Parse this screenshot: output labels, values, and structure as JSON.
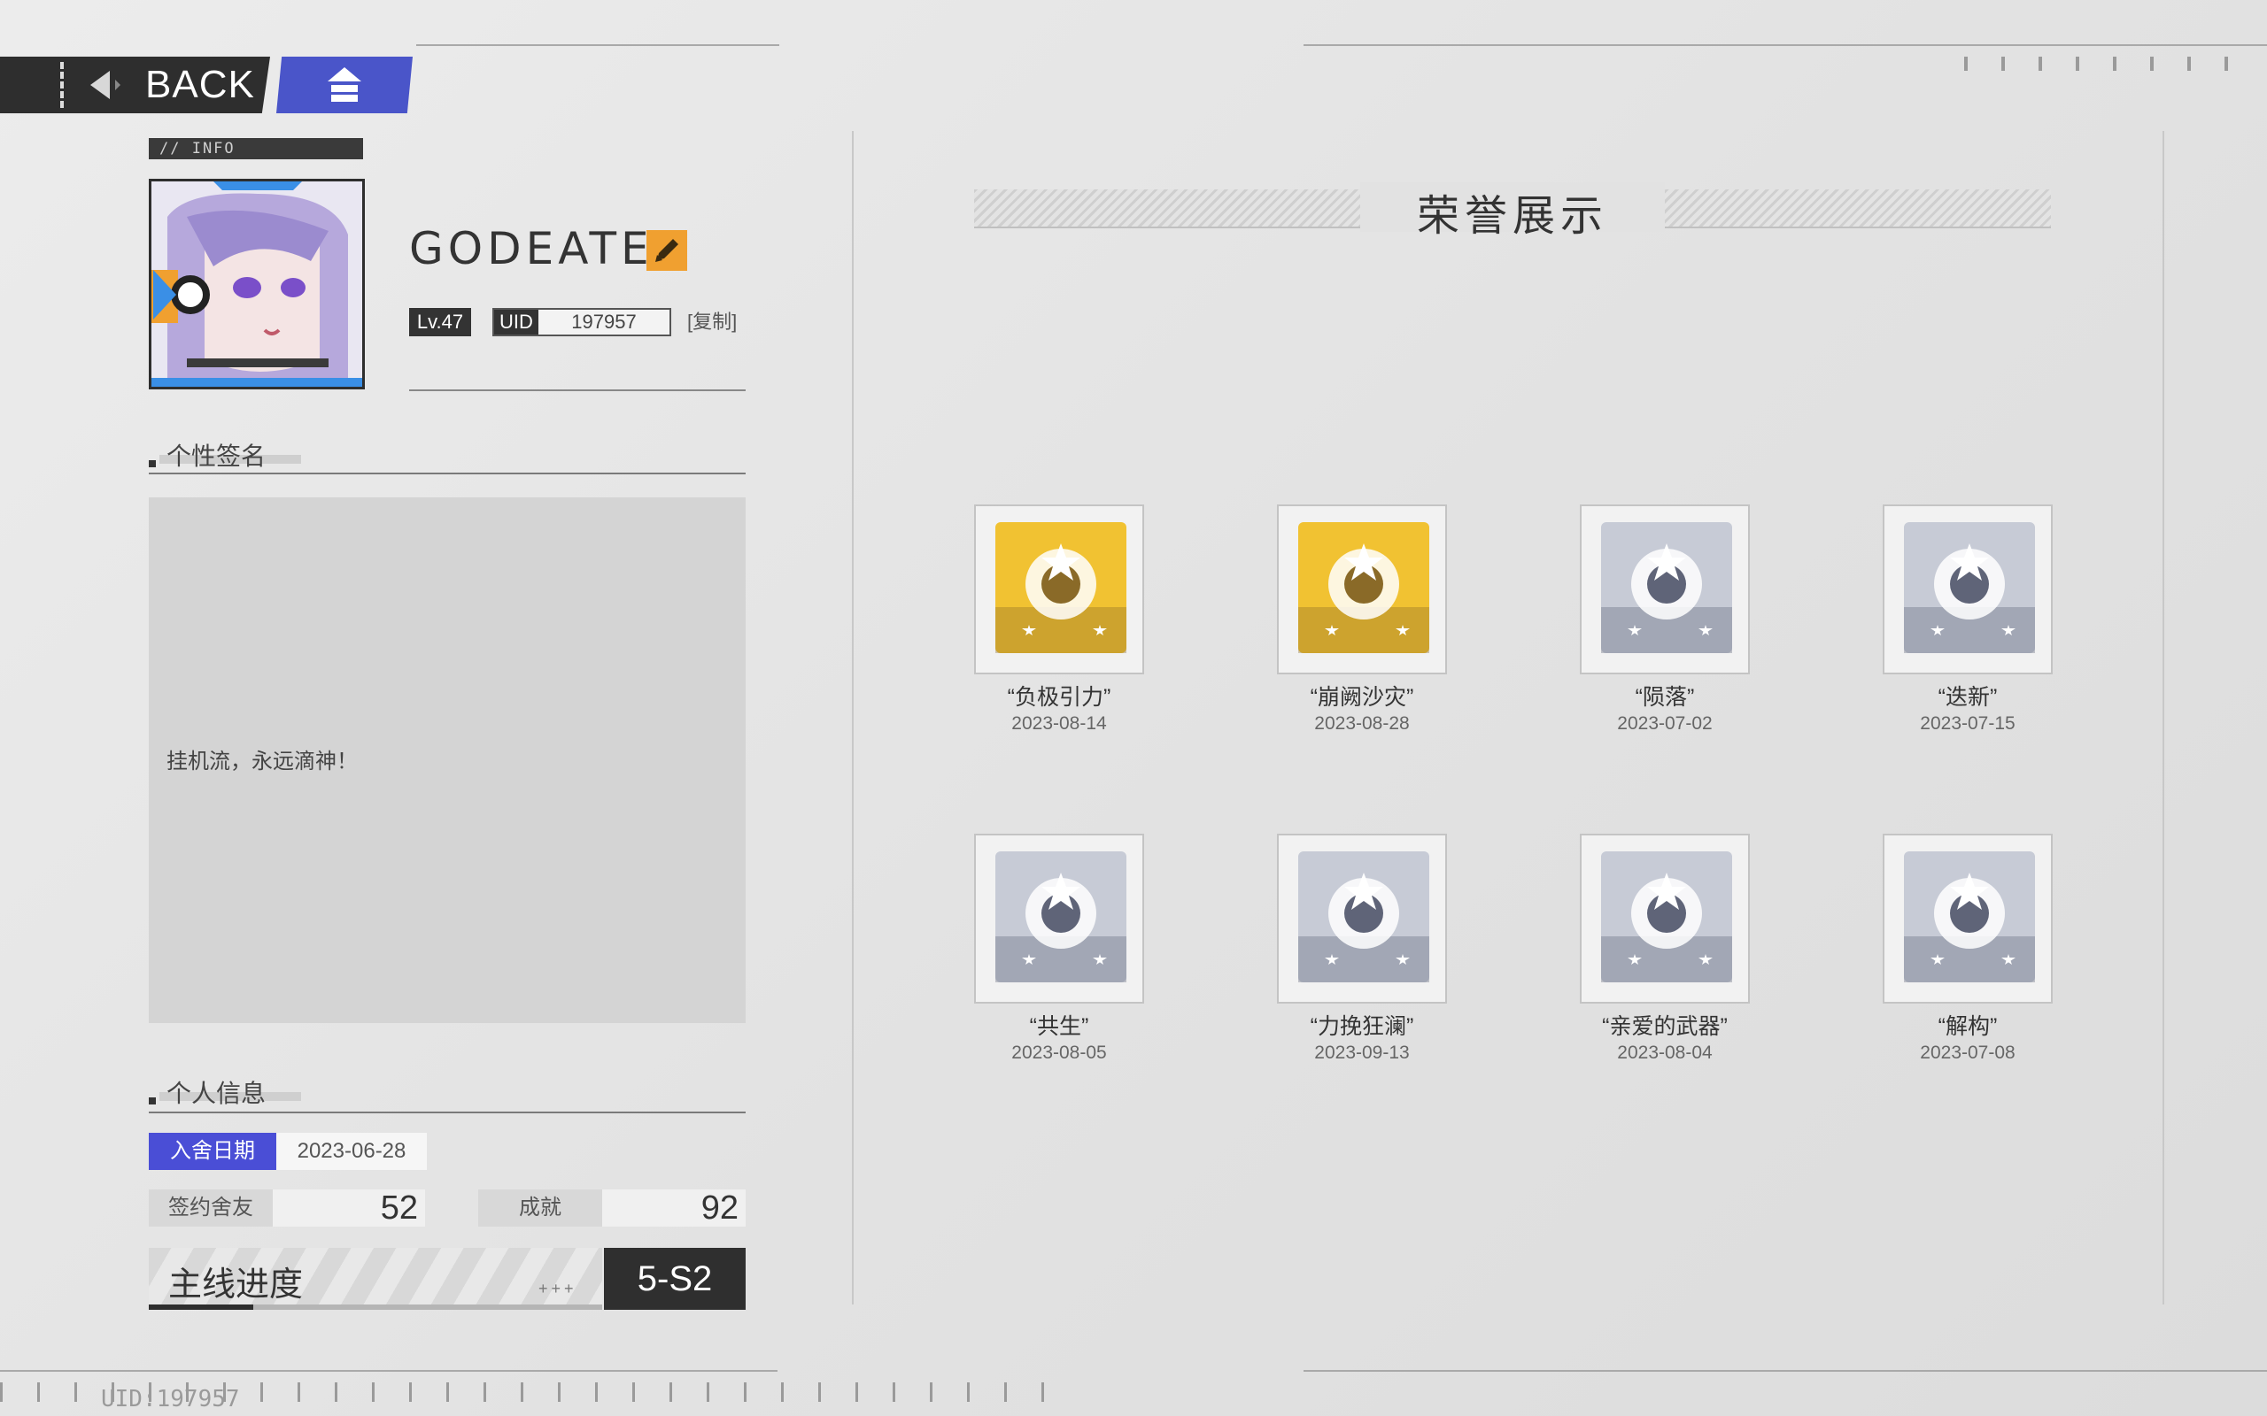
{
  "nav": {
    "back_label": "BACK"
  },
  "profile": {
    "info_tag": "// INFO",
    "name": "GODEATER",
    "level": "Lv.47",
    "uid_label": "UID",
    "uid": "197957",
    "copy_label": "[复制]"
  },
  "signature": {
    "title": "个性签名",
    "text": "挂机流，永远滴神！"
  },
  "personal": {
    "title": "个人信息",
    "join_label": "入舍日期",
    "join_date": "2023-06-28",
    "friends_label": "签约舍友",
    "friends_value": "52",
    "achievements_label": "成就",
    "achievements_value": "92",
    "progress_label": "主线进度",
    "progress_plus": "+++",
    "progress_value": "5-S2",
    "progress_fill_fraction": 0.23
  },
  "honor": {
    "title": "荣誉展示",
    "medals": [
      {
        "name": "“负极引力”",
        "date": "2023-08-14",
        "tier": "gold",
        "icon": "medal-gravity-icon"
      },
      {
        "name": "“崩阙沙灾”",
        "date": "2023-08-28",
        "tier": "gold",
        "icon": "medal-sand-icon"
      },
      {
        "name": "“陨落”",
        "date": "2023-07-02",
        "tier": "silver",
        "icon": "medal-fall-icon"
      },
      {
        "name": "“迭新”",
        "date": "2023-07-15",
        "tier": "silver",
        "icon": "medal-renew-icon"
      },
      {
        "name": "“共生”",
        "date": "2023-08-05",
        "tier": "silver",
        "icon": "medal-symbiosis-icon"
      },
      {
        "name": "“力挽狂澜”",
        "date": "2023-09-13",
        "tier": "silver",
        "icon": "medal-tide-icon"
      },
      {
        "name": "“亲爱的武器”",
        "date": "2023-08-04",
        "tier": "silver",
        "icon": "medal-weapon-icon"
      },
      {
        "name": "“解构”",
        "date": "2023-07-08",
        "tier": "silver",
        "icon": "medal-deconstruct-icon"
      }
    ]
  },
  "footer": {
    "uid_text": "UID:197957"
  },
  "colors": {
    "accent": "#4a4ed6",
    "home": "#4a55c9",
    "gold": "#e8b830",
    "dark": "#2e2e2e"
  }
}
